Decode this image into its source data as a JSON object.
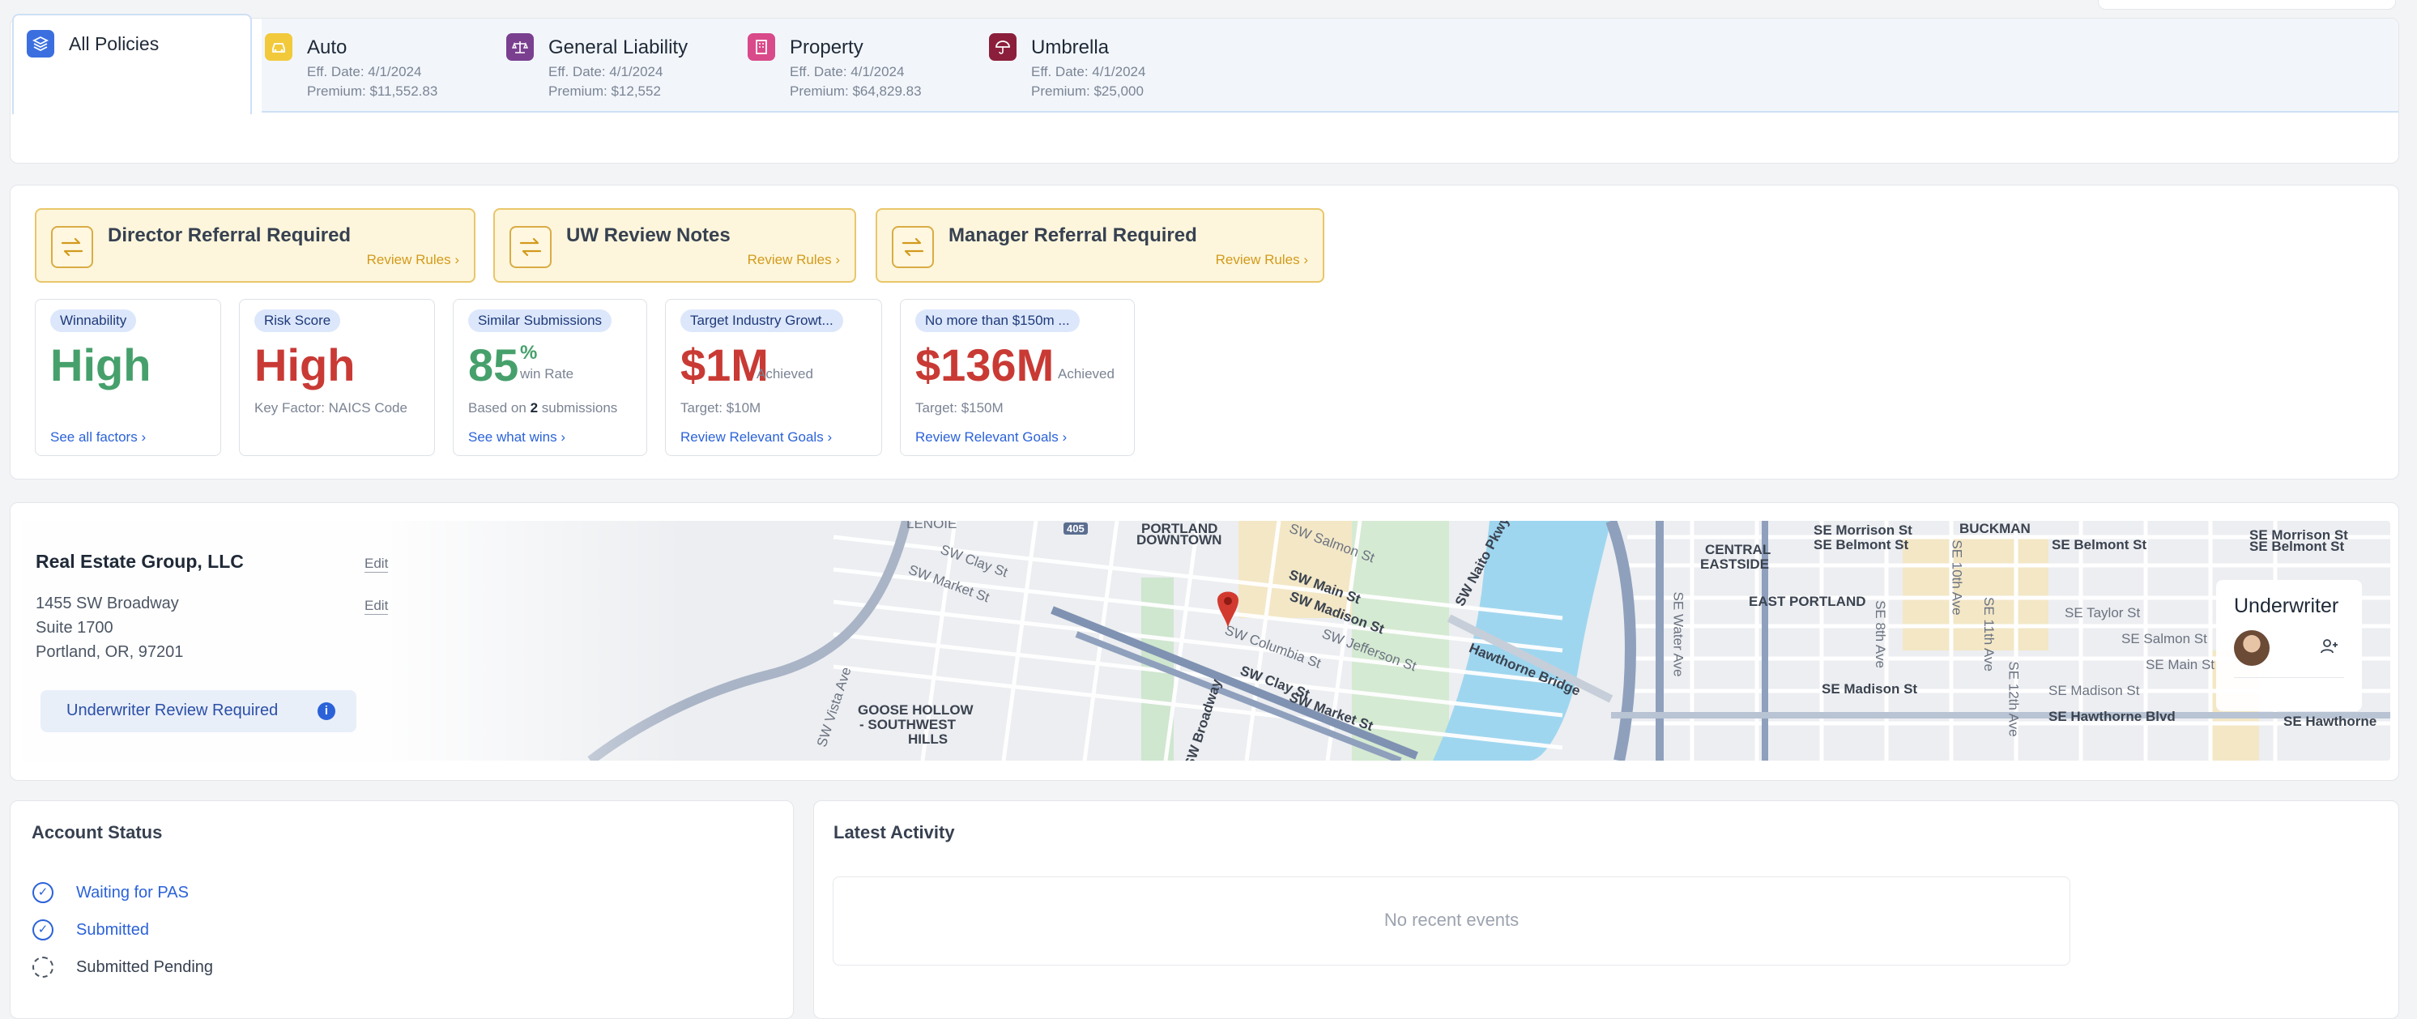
{
  "policy_tabs": {
    "all": {
      "label": "All Policies"
    },
    "items": [
      {
        "name": "Auto",
        "eff_date": "Eff. Date: 4/1/2024",
        "premium": "Premium: $11,552.83",
        "icon": "car-icon",
        "color": "#f1c93b"
      },
      {
        "name": "General Liability",
        "eff_date": "Eff. Date: 4/1/2024",
        "premium": "Premium: $12,552",
        "icon": "scales-icon",
        "color": "#7a3f8f"
      },
      {
        "name": "Property",
        "eff_date": "Eff. Date: 4/1/2024",
        "premium": "Premium: $64,829.83",
        "icon": "building-icon",
        "color": "#d94a8a"
      },
      {
        "name": "Umbrella",
        "eff_date": "Eff. Date: 4/1/2024",
        "premium": "Premium: $25,000",
        "icon": "umbrella-icon",
        "color": "#8b1f3b"
      }
    ]
  },
  "referrals": [
    {
      "title": "Director Referral Required",
      "link": "Review Rules"
    },
    {
      "title": "UW Review Notes",
      "link": "Review Rules"
    },
    {
      "title": "Manager Referral Required",
      "link": "Review Rules"
    }
  ],
  "metrics": {
    "winnability": {
      "pill": "Winnability",
      "value": "High",
      "link": "See all factors"
    },
    "risk": {
      "pill": "Risk Score",
      "value": "High",
      "sub": "Key Factor: NAICS Code"
    },
    "similar": {
      "pill": "Similar Submissions",
      "value": "85",
      "unit": "%",
      "small": "win Rate",
      "sub_pre": "Based on ",
      "sub_bold": "2",
      "sub_post": " submissions",
      "link": "See what wins"
    },
    "industry": {
      "pill": "Target Industry Growt...",
      "value": "$1M",
      "small": "Achieved",
      "sub": "Target: $10M",
      "link": "Review Relevant Goals"
    },
    "limit": {
      "pill": "No more than $150m ...",
      "value": "$136M",
      "small": "Achieved",
      "sub": "Target: $150M",
      "link": "Review Relevant Goals"
    }
  },
  "account": {
    "company": "Real Estate Group, LLC",
    "edit": "Edit",
    "address_line1": "1455 SW Broadway",
    "address_line2": "Suite 1700",
    "address_line3": "Portland, OR, 97201",
    "badge": "Underwriter Review Required"
  },
  "map_labels": {
    "portland": "PORTLAND",
    "downtown": "DOWNTOWN",
    "goose1": "GOOSE HOLLOW",
    "goose2": "- SOUTHWEST",
    "goose3": "HILLS",
    "central1": "CENTRAL",
    "central2": "EASTSIDE",
    "east_portland": "EAST PORTLAND",
    "buckman": "BUCKMAN",
    "lenoir": "LENOIE",
    "swmain": "SW Main St",
    "swmadison": "SW Madison St",
    "swclay": "SW Clay St",
    "swmarket": "SW Market St",
    "swcolumbia": "SW Columbia St",
    "swjefferson": "SW Jefferson St",
    "swsalmon": "SW Salmon St",
    "swclay_small": "SW Clay St",
    "swmarket_small": "SW Market St",
    "swvista": "SW Vista Ave",
    "swbroadway": "SW Broadway",
    "naito": "SW Naito Pkwy",
    "hawthorne": "Hawthorne Bridge",
    "semorrison": "SE Morrison St",
    "semorrison2": "SE Morrison St",
    "sebelmont": "SE Belmont St",
    "sebelmont2": "SE Belmont St",
    "sebelmont3": "SE Belmont St",
    "setaylor": "SE Taylor St",
    "sesalmon": "SE Salmon St",
    "semain": "SE Main St",
    "semadison": "SE Madison St",
    "semadison2": "SE Madison St",
    "sehawthorne": "SE Hawthorne Blvd",
    "sehawthorne2": "SE Hawthorne",
    "sewater": "SE Water Ave",
    "se8th": "SE 8th Ave",
    "se11th": "SE 11th Ave",
    "se12th": "SE 12th Ave",
    "se10th": "SE 10th Ave",
    "hwy": "405"
  },
  "underwriter": {
    "title": "Underwriter",
    "add_icon": "add-user-icon"
  },
  "account_status": {
    "title": "Account Status",
    "items": [
      {
        "label": "Waiting for PAS",
        "state": "done"
      },
      {
        "label": "Submitted",
        "state": "done"
      },
      {
        "label": "Submitted Pending",
        "state": "pending"
      }
    ]
  },
  "activity": {
    "title": "Latest Activity",
    "empty": "No recent events"
  }
}
